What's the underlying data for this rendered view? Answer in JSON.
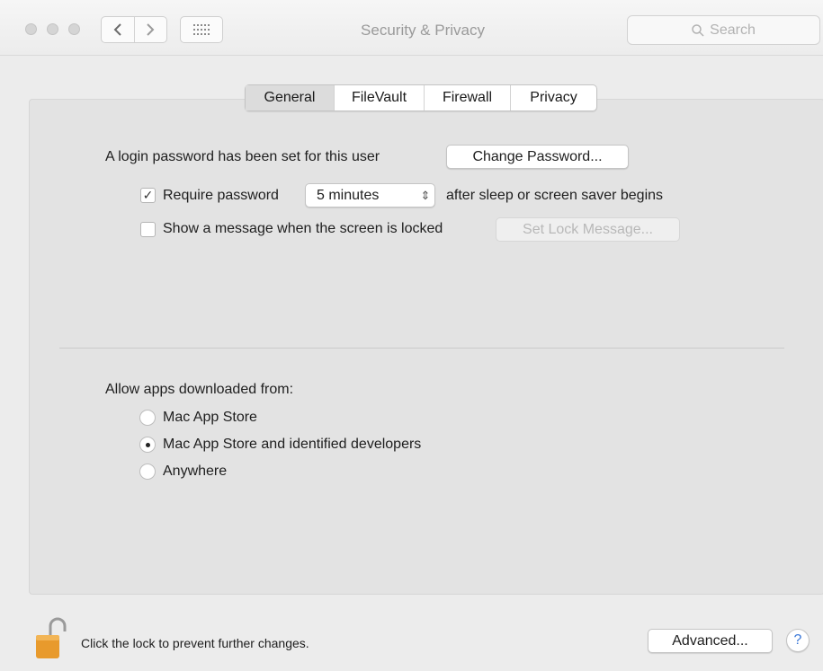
{
  "window": {
    "title": "Security & Privacy",
    "search_placeholder": "Search"
  },
  "tabs": [
    {
      "label": "General",
      "active": true
    },
    {
      "label": "FileVault",
      "active": false
    },
    {
      "label": "Firewall",
      "active": false
    },
    {
      "label": "Privacy",
      "active": false
    }
  ],
  "general": {
    "login_text": "A login password has been set for this user",
    "change_password_label": "Change Password...",
    "require_password": {
      "checked": true,
      "label": "Require password",
      "delay_value": "5 minutes",
      "suffix": "after sleep or screen saver begins"
    },
    "show_message": {
      "checked": false,
      "label": "Show a message when the screen is locked",
      "button_label": "Set Lock Message..."
    }
  },
  "apps": {
    "heading": "Allow apps downloaded from:",
    "options": [
      {
        "label": "Mac App Store",
        "selected": false
      },
      {
        "label": "Mac App Store and identified developers",
        "selected": true
      },
      {
        "label": "Anywhere",
        "selected": false
      }
    ]
  },
  "footer": {
    "lock_text": "Click the lock to prevent further changes.",
    "advanced_label": "Advanced...",
    "help_glyph": "?"
  },
  "colors": {
    "window_bg": "#ececec",
    "panel_bg": "#e3e3e3",
    "lock_gold": "#e89a2c",
    "help_blue": "#3b78d8"
  }
}
